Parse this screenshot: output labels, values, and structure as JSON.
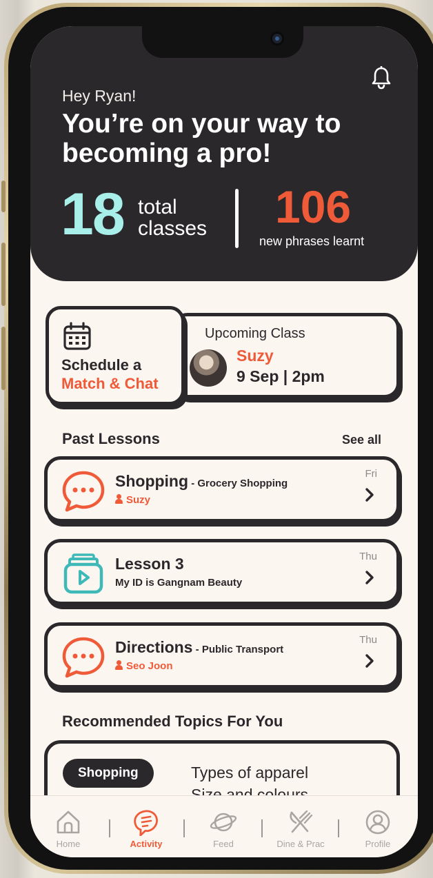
{
  "hero": {
    "greeting": "Hey Ryan!",
    "headline": "You’re on your way to becoming a pro!",
    "total_classes": "18",
    "total_classes_label_1": "total",
    "total_classes_label_2": "classes",
    "phrases": "106",
    "phrases_label": "new phrases learnt",
    "notification_icon": "bell-icon"
  },
  "schedule": {
    "icon": "calendar-icon",
    "line1": "Schedule a",
    "line2": "Match & Chat"
  },
  "upcoming": {
    "title": "Upcoming Class",
    "name": "Suzy",
    "when": "9 Sep | 2pm"
  },
  "past_lessons": {
    "title": "Past Lessons",
    "see_all": "See all",
    "items": [
      {
        "title": "Shopping",
        "subtitle": " - Grocery Shopping",
        "person": "Suzy",
        "day": "Fri",
        "icon": "chat-bubble-icon"
      },
      {
        "title": "Lesson 3",
        "subtitle": "",
        "description": "My ID is Gangnam Beauty",
        "day": "Thu",
        "icon": "video-lesson-icon"
      },
      {
        "title": "Directions",
        "subtitle": " - Public Transport",
        "person": "Seo Joon",
        "day": "Thu",
        "icon": "chat-bubble-icon"
      }
    ]
  },
  "recommended": {
    "title": "Recommended Topics For You",
    "pill": "Shopping",
    "topics": [
      "Types of apparel",
      "Size and colours"
    ]
  },
  "tabs": [
    {
      "label": "Home",
      "icon": "home-icon"
    },
    {
      "label": "Activity",
      "icon": "activity-icon",
      "active": true
    },
    {
      "label": "Feed",
      "icon": "planet-icon"
    },
    {
      "label": "Dine & Prac",
      "icon": "utensils-icon"
    },
    {
      "label": "Profile",
      "icon": "profile-icon"
    }
  ],
  "colors": {
    "dark": "#2b282b",
    "accent": "#ef5a38",
    "teal": "#a8efe9",
    "background": "#fcf6f1"
  }
}
